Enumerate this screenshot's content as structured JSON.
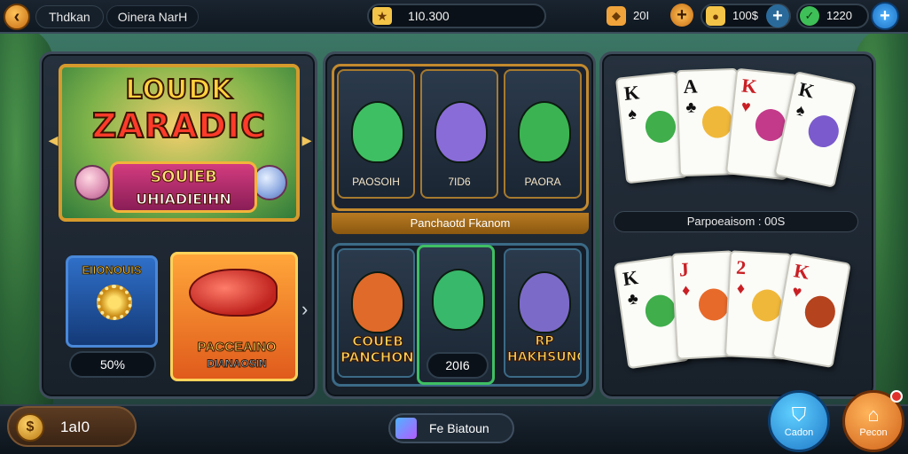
{
  "topbar": {
    "back_icon": "chevron-left-icon",
    "title": "Thdkan",
    "subtitle": "Oinera NarH",
    "score": "1I0.300",
    "currencies": [
      {
        "name": "gem",
        "icon": "diamond-icon",
        "value": "20I",
        "color": "#f0a33a"
      },
      {
        "name": "coin",
        "icon": "coin-icon",
        "value": "100$",
        "color": "#f3c447"
      },
      {
        "name": "clover",
        "icon": "clover-icon",
        "value": "1220",
        "color": "#3fbf57"
      }
    ]
  },
  "featured": {
    "title_line1": "LOUDK",
    "title_line2": "ZARADIC",
    "banner_line1": "SOUIEB",
    "banner_line2": "UHIADIEIHN"
  },
  "bonus": {
    "label": "EIIONOUIS",
    "percent": "50%"
  },
  "promo": {
    "line1": "PACCEAINO",
    "line2": "DIANAOSIN"
  },
  "fish_top": [
    {
      "label": "PAOSOIH",
      "color": "#3fbf63"
    },
    {
      "label": "7ID6",
      "color": "#8a6cd8"
    },
    {
      "label": "PAORA",
      "color": "#3bb352"
    }
  ],
  "fish_top_caption": "Panchaotd Fkanom",
  "fish_bottom": [
    {
      "label": "COUEB PANCHONS",
      "color": "#e06a2a"
    },
    {
      "label": "20I6",
      "color": "#38b86a"
    },
    {
      "label": "RP HAKHSUNG",
      "color": "#7c6ac8"
    }
  ],
  "cards_top": [
    {
      "rank": "K",
      "suit": "♠",
      "color": "black"
    },
    {
      "rank": "A",
      "suit": "♣",
      "color": "black"
    },
    {
      "rank": "K",
      "suit": "♥",
      "color": "red"
    },
    {
      "rank": "K",
      "suit": "♠",
      "color": "black"
    }
  ],
  "multiplier_text": "Parpoeaisom : 00S",
  "cards_bottom": [
    {
      "rank": "K",
      "suit": "♣",
      "color": "black"
    },
    {
      "rank": "J",
      "suit": "♦",
      "color": "red"
    },
    {
      "rank": "2",
      "suit": "♦",
      "color": "red"
    },
    {
      "rank": "K",
      "suit": "♥",
      "color": "red"
    }
  ],
  "bottombar": {
    "coins": "1aI0",
    "center_label": "Fe Biatoun",
    "btn1_label": "Cadon",
    "btn2_label": "Pecon"
  }
}
